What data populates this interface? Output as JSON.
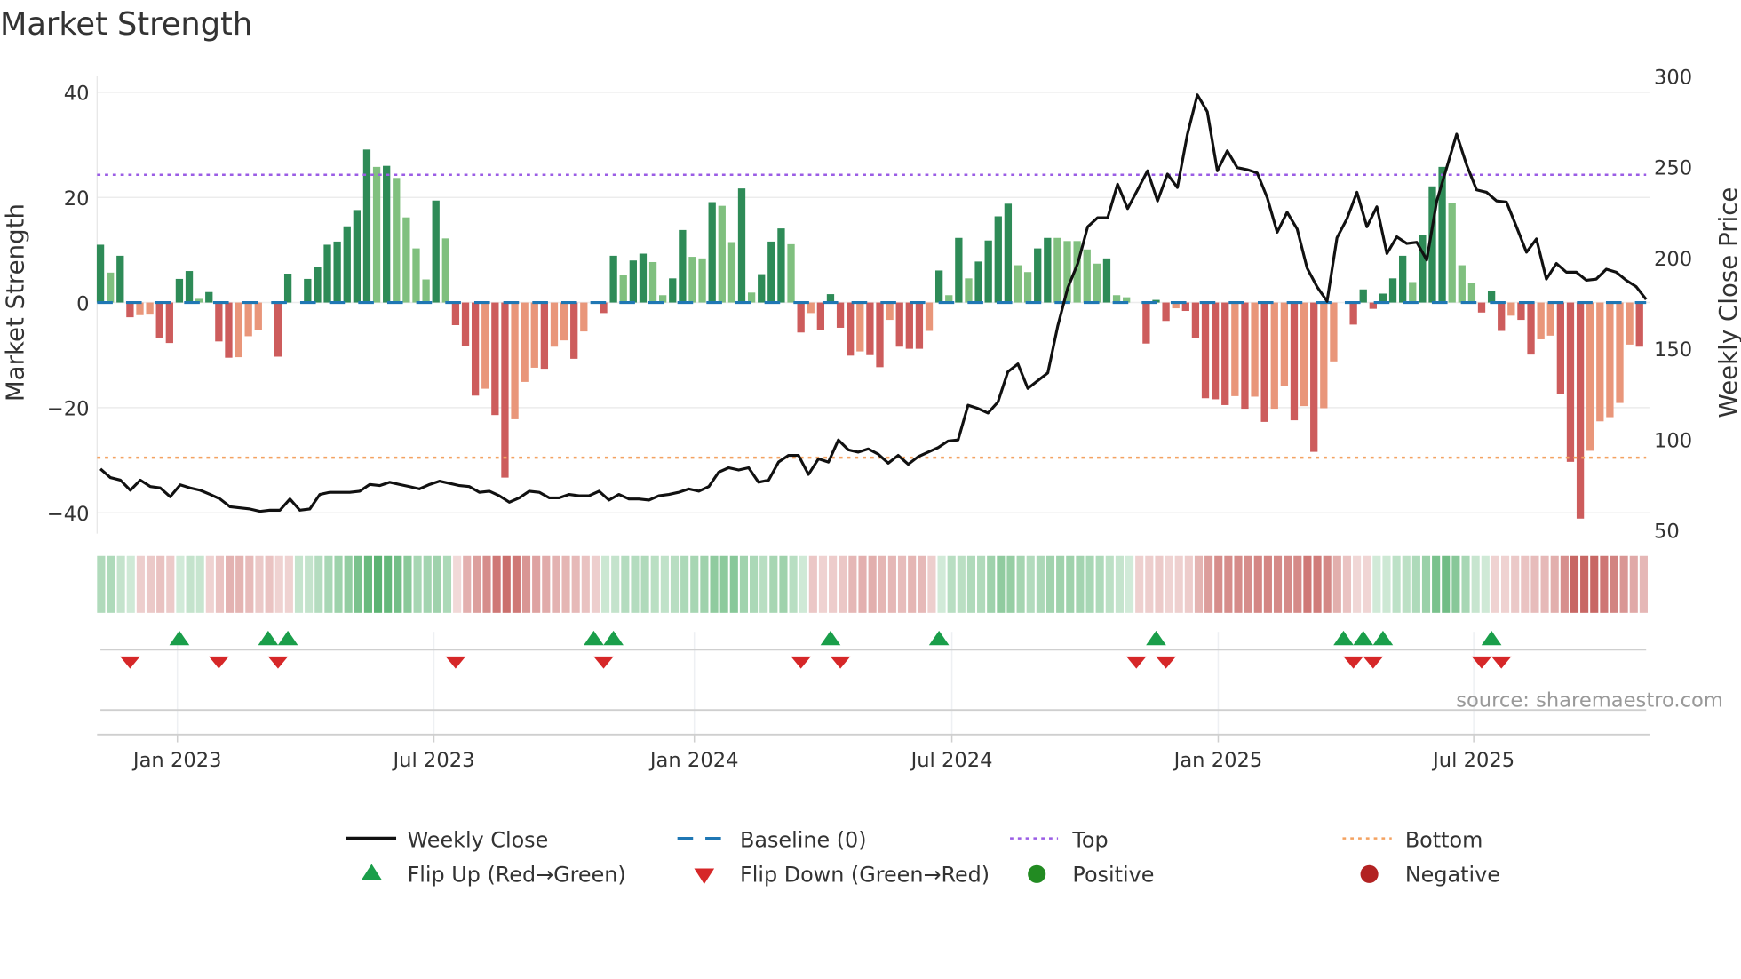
{
  "chart_data": {
    "type": "bar",
    "title": "Market Strength",
    "ylabel": "Market Strength",
    "y2label": "Weekly Close Price",
    "ylim": [
      -44,
      43
    ],
    "y2lim": [
      50,
      300
    ],
    "yticks": [
      40,
      20,
      0,
      -20,
      -40
    ],
    "ytick_labels": [
      "40",
      "20",
      "0",
      "−20",
      "−40"
    ],
    "y2ticks": [
      300,
      250,
      200,
      150,
      100,
      50
    ],
    "y2tick_labels": [
      "300",
      "250",
      "200",
      "150",
      "100",
      "50"
    ],
    "xticks": [
      {
        "label": "Jan 2023",
        "week": 7.8
      },
      {
        "label": "Jul 2023",
        "week": 33.8
      },
      {
        "label": "Jan 2024",
        "week": 60.2
      },
      {
        "label": "Jul 2024",
        "week": 86.3
      },
      {
        "label": "Jan 2025",
        "week": 113.3
      },
      {
        "label": "Jul 2025",
        "week": 139.2
      }
    ],
    "grid": true,
    "top_level": 24.3,
    "bottom_level": -29.5,
    "baseline": 0,
    "strength": [
      11.0,
      5.7,
      8.9,
      -2.8,
      -2.4,
      -2.3,
      -6.8,
      -7.7,
      4.5,
      6.0,
      0.7,
      2.0,
      -7.4,
      -10.5,
      -10.4,
      -6.4,
      -5.2,
      0,
      -10.3,
      5.5,
      0,
      4.5,
      6.8,
      11.0,
      11.6,
      14.5,
      17.6,
      29.1,
      25.8,
      26.0,
      23.7,
      16.2,
      10.3,
      4.4,
      19.4,
      12.2,
      -4.3,
      -8.3,
      -17.7,
      -16.4,
      -21.4,
      -33.3,
      -22.2,
      -15.1,
      -12.4,
      -12.6,
      -8.4,
      -7.2,
      -10.7,
      -5.5,
      0,
      -2.0,
      8.9,
      5.3,
      8.0,
      9.3,
      7.7,
      1.4,
      4.6,
      13.8,
      8.7,
      8.4,
      19.1,
      18.4,
      11.5,
      21.7,
      1.9,
      5.4,
      11.6,
      14.1,
      11.1,
      -5.7,
      -2.0,
      -5.3,
      1.6,
      -4.8,
      -10.1,
      -9.3,
      -10.0,
      -12.3,
      -3.3,
      -8.4,
      -8.8,
      -8.8,
      -5.4,
      6.1,
      1.4,
      12.3,
      4.6,
      7.8,
      11.8,
      16.4,
      18.8,
      7.1,
      5.8,
      10.3,
      12.3,
      12.3,
      11.7,
      11.7,
      10.1,
      7.4,
      8.4,
      1.4,
      1.0,
      0,
      -7.8,
      0.5,
      -3.5,
      -1.1,
      -1.6,
      -6.8,
      -18.2,
      -18.4,
      -19.5,
      -17.8,
      -20.2,
      -17.9,
      -22.7,
      -20.2,
      -15.9,
      -22.4,
      -19.7,
      -28.4,
      -20.1,
      -11.2,
      0,
      -4.2,
      2.5,
      -1.2,
      1.7,
      4.6,
      8.9,
      3.9,
      12.9,
      22.1,
      25.8,
      18.9,
      7.1,
      3.7,
      -1.9,
      2.2,
      -5.4,
      -2.5,
      -3.3,
      -9.9,
      -7.0,
      -6.3,
      -17.4,
      -30.3,
      -41.1,
      -28.2,
      -22.6,
      -21.8,
      -19.1,
      -8.0,
      -8.4
    ],
    "shade": "GgGRrrRRGGgGRRrrr0RG0GGGGGGGgGggggGgRRRrRRrrrRrrRr0RGgGGggGGggGggGgGGGgRrRGRRrRRrRRRrGgGgGGGGggGGgggggGgg0RGRrRRRRRrRrRrrRrRrr0RGRGGGgGGGgggRGRrRRrrRRRrrrrrR",
    "weekly_close": [
      83.8,
      79,
      77.6,
      72,
      77.6,
      74,
      73.3,
      68.4,
      75,
      73.3,
      72,
      69.7,
      67.2,
      62.9,
      62.3,
      61.7,
      60.4,
      61,
      61,
      67.2,
      61,
      61.7,
      69.7,
      70.9,
      70.9,
      70.9,
      71.5,
      75.2,
      74.6,
      76.4,
      75.2,
      74,
      72.7,
      75.2,
      77,
      75.8,
      74.6,
      74,
      70.9,
      71.5,
      69,
      65.4,
      67.8,
      71.5,
      70.9,
      67.8,
      67.8,
      69.7,
      69,
      69,
      71.5,
      66.6,
      69.7,
      67.2,
      67.2,
      66.6,
      69,
      69.7,
      70.9,
      72.7,
      71.5,
      74,
      82,
      84.4,
      83.2,
      84.4,
      76.4,
      77.6,
      87.5,
      91.2,
      91.2,
      80.7,
      89.3,
      87.5,
      99.7,
      94.2,
      93,
      94.8,
      91.8,
      86.9,
      91.2,
      86.3,
      90.5,
      93,
      95.5,
      99.1,
      99.7,
      118.8,
      117,
      114.5,
      120.6,
      137.2,
      141.5,
      128,
      132.3,
      136.6,
      162.4,
      183.3,
      196.8,
      217,
      222,
      222,
      240.4,
      227,
      237.3,
      247.8,
      231.2,
      246,
      238.6,
      268,
      289.6,
      280.3,
      247.8,
      258.8,
      249.6,
      248.4,
      246.6,
      233,
      214,
      225,
      215.8,
      194.3,
      184,
      176,
      211,
      221.4,
      236,
      217,
      228,
      202.3,
      211.5,
      207.8,
      208.5,
      198.7,
      231.2,
      249.6,
      268,
      250.9,
      237.3,
      236,
      231.2,
      230.6,
      217,
      203,
      210.3,
      188.2,
      196.8,
      192,
      192,
      187.6,
      188.2,
      193.7,
      192,
      187.6,
      184,
      177
    ],
    "flip_up_weeks": [
      8,
      17,
      19,
      50,
      52,
      74,
      85,
      107,
      126,
      128,
      130,
      141
    ],
    "flip_down_weeks": [
      3,
      12,
      18,
      36,
      51,
      71,
      75,
      105,
      108,
      127,
      129,
      140,
      142
    ],
    "legend": {
      "placement": "bottom",
      "weekly_close": "Weekly Close",
      "baseline": "Baseline (0)",
      "top": "Top",
      "bottom": "Bottom",
      "flip_up": "Flip Up (Red→Green)",
      "flip_down": "Flip Down (Green→Red)",
      "positive": "Positive",
      "negative": "Negative"
    },
    "annotation": "source: sharemaestro.com"
  },
  "colors": {
    "strong_green": "#2e8b57",
    "weak_green": "#80c07f",
    "strong_red": "#cd5c5c",
    "weak_red": "#e9967a",
    "baseline": "#1f77b4",
    "top": "#9b5de5",
    "bottom": "#f4a261",
    "close": "#111111",
    "flip_up": "#1a9e4a",
    "flip_down": "#d62728",
    "positive": "#228b22",
    "negative": "#b22222",
    "heat_green": "#3fa65a",
    "heat_red": "#c0504d"
  }
}
